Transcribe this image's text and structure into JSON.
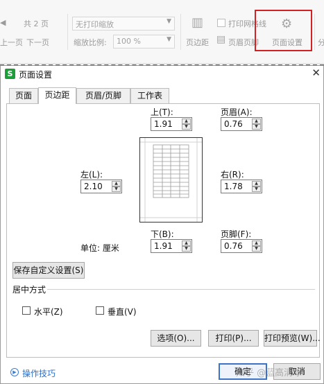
{
  "toolbar": {
    "page_prefix": "◀",
    "total_pages": "共 2 页",
    "prev_page": "上一页",
    "next_page": "下一页",
    "scale_mode": "无打印缩放",
    "zoom_label": "缩放比例:",
    "zoom_value": "100 %",
    "margins_label": "页边距",
    "print_gridlines": "打印网格线",
    "header_footer_label": "页眉页脚",
    "page_setup_label": "页面设置",
    "split_label": "分"
  },
  "dialog": {
    "title": "页面设置",
    "app_logo": "S",
    "tabs": [
      {
        "label": "页面"
      },
      {
        "label": "页边距"
      },
      {
        "label": "页眉/页脚"
      },
      {
        "label": "工作表"
      }
    ],
    "active_tab": "页边距",
    "margins": {
      "top": {
        "label": "上(T):",
        "value": "1.91"
      },
      "header": {
        "label": "页眉(A):",
        "value": "0.76"
      },
      "left": {
        "label": "左(L):",
        "value": "2.10"
      },
      "right": {
        "label": "右(R):",
        "value": "1.78"
      },
      "bottom": {
        "label": "下(B):",
        "value": "1.91"
      },
      "footer": {
        "label": "页脚(F):",
        "value": "0.76"
      }
    },
    "unit_label": "单位:  厘米",
    "save_custom_button": "保存自定义设置(S)",
    "center_group_label": "居中方式",
    "center_horizontal": "水平(Z)",
    "center_vertical": "垂直(V)",
    "options_button": "选项(O)...",
    "print_button": "打印(P)...",
    "print_preview_button": "打印预览(W)...",
    "tips_link": "操作技巧",
    "ok_button": "确定",
    "cancel_button": "取消"
  },
  "watermark": "知乎 @蓝高清冰",
  "colors": {
    "highlight_box": "#d42020",
    "app_logo": "#1e9e3a",
    "link": "#2c6fc9"
  }
}
